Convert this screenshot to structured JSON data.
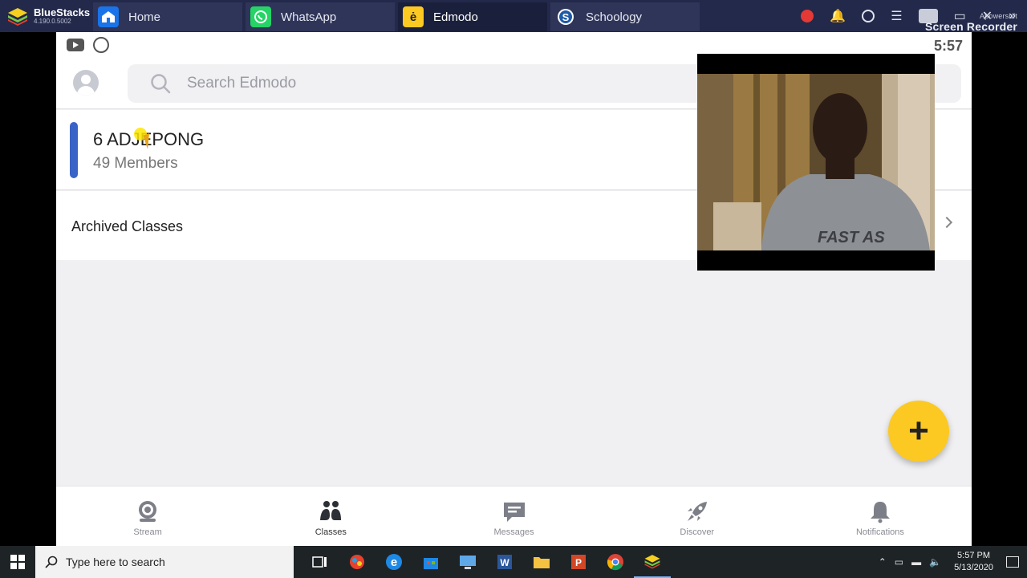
{
  "bluestacks": {
    "brand": "BlueStacks",
    "version": "4.190.0.5002",
    "tabs": [
      {
        "label": "Home",
        "icon": "home-icon",
        "color": "#1a73e8"
      },
      {
        "label": "WhatsApp",
        "icon": "whatsapp-icon",
        "color": "#25d366"
      },
      {
        "label": "Edmodo",
        "icon": "edmodo-icon",
        "color": "#fcc922",
        "active": true
      },
      {
        "label": "Schoology",
        "icon": "schoology-icon",
        "color": "#1e5aa8"
      }
    ],
    "recorder_brand": "Apowersoft",
    "recorder_label": "Screen Recorder"
  },
  "status_bar": {
    "time": "5:57"
  },
  "search": {
    "placeholder": "Search Edmodo"
  },
  "classes": [
    {
      "name": "6 ADJEPONG",
      "members": "49 Members",
      "color": "#3a63c8"
    }
  ],
  "archived": {
    "label": "Archived Classes"
  },
  "fab": {
    "label": "+"
  },
  "bottom_nav": [
    {
      "label": "Stream",
      "icon": "stream-icon"
    },
    {
      "label": "Classes",
      "icon": "classes-icon",
      "active": true
    },
    {
      "label": "Messages",
      "icon": "messages-icon"
    },
    {
      "label": "Discover",
      "icon": "rocket-icon"
    },
    {
      "label": "Notifications",
      "icon": "bell-icon"
    }
  ],
  "taskbar": {
    "search_placeholder": "Type here to search",
    "time": "5:57 PM",
    "date": "5/13/2020"
  }
}
